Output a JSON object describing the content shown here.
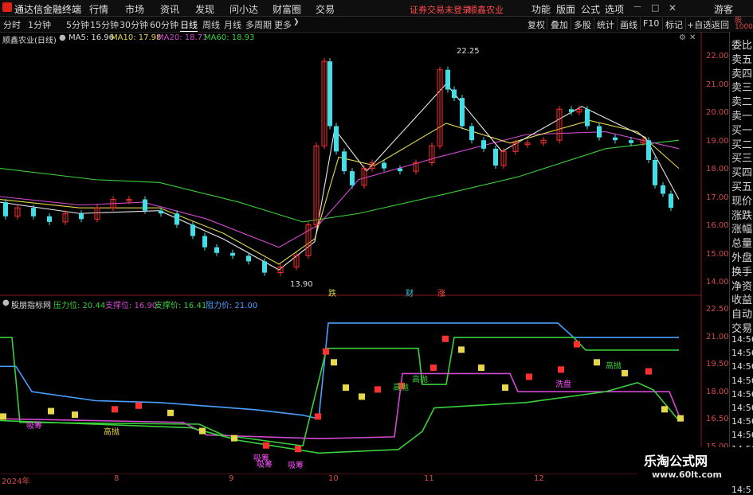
{
  "titlebar": {
    "app_title": "通达信金融终端",
    "menus": [
      "行情",
      "市场",
      "资讯",
      "发现",
      "问小达",
      "财富圈",
      "交易"
    ],
    "status_text": "证券交易未登录",
    "stock_name": "顺鑫农业",
    "right_buttons": [
      "功能",
      "版面",
      "公式",
      "选项"
    ],
    "guest": "游客"
  },
  "toolbar": {
    "timeframes": [
      "分时",
      "1分钟",
      "5分钟",
      "15分钟",
      "30分钟",
      "60分钟",
      "日线",
      "周线",
      "月线",
      "多周期",
      "更多"
    ],
    "active": "日线",
    "right_tools": [
      "复权",
      "叠加",
      "多股",
      "统计",
      "画线",
      "F10",
      "标记",
      "+自选",
      "返回"
    ]
  },
  "main_chart": {
    "title": "顺鑫农业(日线)",
    "ma_legend": [
      {
        "label": "MA5: 16.96",
        "color": "#e8e8e8"
      },
      {
        "label": "MA10: 17.98",
        "color": "#e6d84a"
      },
      {
        "label": "MA20: 18.71",
        "color": "#d24ad2"
      },
      {
        "label": "MA60: 18.93",
        "color": "#3ad03a"
      }
    ],
    "y_ticks": [
      "22.00",
      "21.00",
      "20.00",
      "19.00",
      "18.00",
      "17.00",
      "16.00",
      "15.00",
      "14.00"
    ],
    "high_label": "22.25",
    "low_label": "13.90",
    "markers": [
      "跌",
      "财",
      "涨"
    ]
  },
  "indicator_chart": {
    "title": "股朋指标网",
    "legend": [
      {
        "label": "压力位: 20.44",
        "color": "#3ad03a"
      },
      {
        "label": "支撑位: 16.90",
        "color": "#d24ad2"
      },
      {
        "label": "支撑价: 16.41",
        "color": "#3ad03a"
      },
      {
        "label": "阻力价: 21.00",
        "color": "#4aa0ff"
      }
    ],
    "y_ticks": [
      "22.50",
      "21.00",
      "19.50",
      "18.00",
      "16.50",
      "15.00"
    ],
    "labels": [
      "高抛",
      "高抛",
      "高抛",
      "高抛",
      "洗盘",
      "吸筹",
      "吸筹",
      "吸筹",
      "吸筹"
    ]
  },
  "side_panel": {
    "items": [
      "委比",
      "卖五",
      "卖四",
      "卖三",
      "卖二",
      "卖一",
      "买一",
      "买二",
      "买三",
      "买四",
      "买五",
      "现价",
      "涨跌",
      "涨幅",
      "总量",
      "外盘",
      "换手",
      "净资",
      "收益",
      "自动",
      "交易"
    ],
    "times": [
      "14:56",
      "14:56",
      "14:56",
      "14:56",
      "14:56",
      "14:56",
      "14:56",
      "14:56",
      "14:56",
      "14:56",
      "14:56",
      "14:5"
    ]
  },
  "date_axis": [
    "2024年",
    "8",
    "9",
    "10",
    "11",
    "12"
  ],
  "watermark": {
    "line1": "乐淘公式网",
    "line2": "www.60lt.com"
  },
  "colors": {
    "up": "#ff3030",
    "down": "#40e0e8",
    "ma5": "#e8e8e8",
    "ma10": "#e6d84a",
    "ma20": "#d24ad2",
    "ma60": "#3ad03a",
    "resist": "#4aa0ff"
  }
}
